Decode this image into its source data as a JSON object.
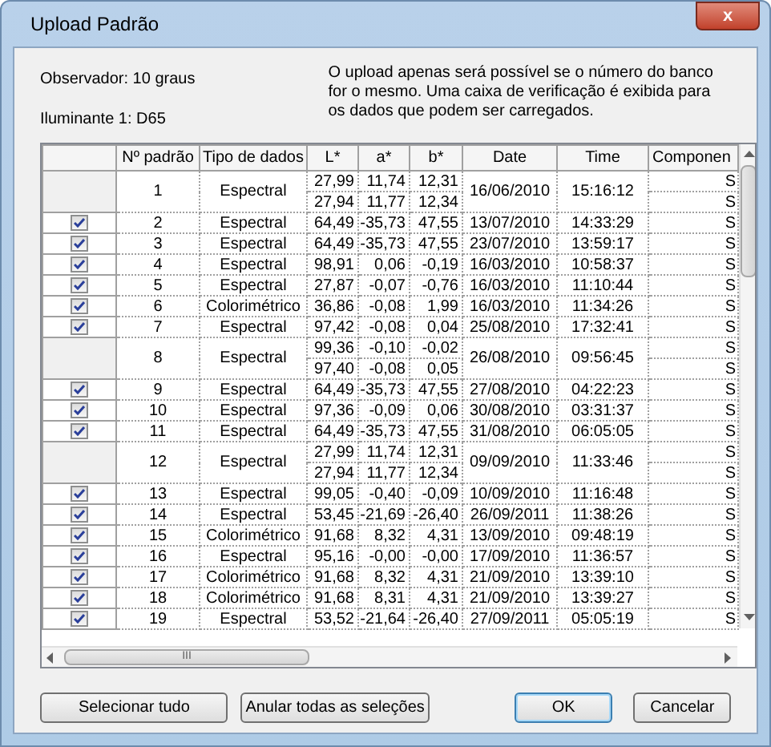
{
  "window": {
    "title": "Upload Padrão",
    "close": "x"
  },
  "info": {
    "observer": "Observador:  10 graus",
    "illuminant": "Iluminante 1:  D65",
    "note": "O upload apenas será possível se o número do banco for o mesmo. Uma caixa de verificação é exibida para os dados que podem ser carregados."
  },
  "table": {
    "columns": [
      "Nº padrão",
      "Tipo de dados",
      "L*",
      "a*",
      "b*",
      "Date",
      "Time",
      "Componen"
    ],
    "rows": [
      {
        "checked": false,
        "no": "1",
        "type": "Espectral",
        "L": [
          "27,99",
          "27,94"
        ],
        "a": [
          "11,74",
          "11,77"
        ],
        "b": [
          "12,31",
          "12,34"
        ],
        "date": "16/06/2010",
        "time": "15:16:12",
        "component": [
          "S",
          "S"
        ]
      },
      {
        "checked": true,
        "no": "2",
        "type": "Espectral",
        "L": [
          "64,49"
        ],
        "a": [
          "-35,73"
        ],
        "b": [
          "47,55"
        ],
        "date": "13/07/2010",
        "time": "14:33:29",
        "component": [
          "S"
        ]
      },
      {
        "checked": true,
        "no": "3",
        "type": "Espectral",
        "L": [
          "64,49"
        ],
        "a": [
          "-35,73"
        ],
        "b": [
          "47,55"
        ],
        "date": "23/07/2010",
        "time": "13:59:17",
        "component": [
          "S"
        ]
      },
      {
        "checked": true,
        "no": "4",
        "type": "Espectral",
        "L": [
          "98,91"
        ],
        "a": [
          "0,06"
        ],
        "b": [
          "-0,19"
        ],
        "date": "16/03/2010",
        "time": "10:58:37",
        "component": [
          "S"
        ]
      },
      {
        "checked": true,
        "no": "5",
        "type": "Espectral",
        "L": [
          "27,87"
        ],
        "a": [
          "-0,07"
        ],
        "b": [
          "-0,76"
        ],
        "date": "16/03/2010",
        "time": "11:10:44",
        "component": [
          "S"
        ]
      },
      {
        "checked": true,
        "no": "6",
        "type": "Colorimétrico",
        "L": [
          "36,86"
        ],
        "a": [
          "-0,08"
        ],
        "b": [
          "1,99"
        ],
        "date": "16/03/2010",
        "time": "11:34:26",
        "component": [
          "S"
        ]
      },
      {
        "checked": true,
        "no": "7",
        "type": "Espectral",
        "L": [
          "97,42"
        ],
        "a": [
          "-0,08"
        ],
        "b": [
          "0,04"
        ],
        "date": "25/08/2010",
        "time": "17:32:41",
        "component": [
          "S"
        ]
      },
      {
        "checked": false,
        "no": "8",
        "type": "Espectral",
        "L": [
          "99,36",
          "97,40"
        ],
        "a": [
          "-0,10",
          "-0,08"
        ],
        "b": [
          "-0,02",
          "0,05"
        ],
        "date": "26/08/2010",
        "time": "09:56:45",
        "component": [
          "S",
          "S"
        ]
      },
      {
        "checked": true,
        "no": "9",
        "type": "Espectral",
        "L": [
          "64,49"
        ],
        "a": [
          "-35,73"
        ],
        "b": [
          "47,55"
        ],
        "date": "27/08/2010",
        "time": "04:22:23",
        "component": [
          "S"
        ]
      },
      {
        "checked": true,
        "no": "10",
        "type": "Espectral",
        "L": [
          "97,36"
        ],
        "a": [
          "-0,09"
        ],
        "b": [
          "0,06"
        ],
        "date": "30/08/2010",
        "time": "03:31:37",
        "component": [
          "S"
        ]
      },
      {
        "checked": true,
        "no": "11",
        "type": "Espectral",
        "L": [
          "64,49"
        ],
        "a": [
          "-35,73"
        ],
        "b": [
          "47,55"
        ],
        "date": "31/08/2010",
        "time": "06:05:05",
        "component": [
          "S"
        ]
      },
      {
        "checked": false,
        "no": "12",
        "type": "Espectral",
        "L": [
          "27,99",
          "27,94"
        ],
        "a": [
          "11,74",
          "11,77"
        ],
        "b": [
          "12,31",
          "12,34"
        ],
        "date": "09/09/2010",
        "time": "11:33:46",
        "component": [
          "S",
          "S"
        ]
      },
      {
        "checked": true,
        "no": "13",
        "type": "Espectral",
        "L": [
          "99,05"
        ],
        "a": [
          "-0,40"
        ],
        "b": [
          "-0,09"
        ],
        "date": "10/09/2010",
        "time": "11:16:48",
        "component": [
          "S"
        ]
      },
      {
        "checked": true,
        "no": "14",
        "type": "Espectral",
        "L": [
          "53,45"
        ],
        "a": [
          "-21,69"
        ],
        "b": [
          "-26,40"
        ],
        "date": "26/09/2011",
        "time": "11:38:26",
        "component": [
          "S"
        ]
      },
      {
        "checked": true,
        "no": "15",
        "type": "Colorimétrico",
        "L": [
          "91,68"
        ],
        "a": [
          "8,32"
        ],
        "b": [
          "4,31"
        ],
        "date": "13/09/2010",
        "time": "09:48:19",
        "component": [
          "S"
        ]
      },
      {
        "checked": true,
        "no": "16",
        "type": "Espectral",
        "L": [
          "95,16"
        ],
        "a": [
          "-0,00"
        ],
        "b": [
          "-0,00"
        ],
        "date": "17/09/2010",
        "time": "11:36:57",
        "component": [
          "S"
        ]
      },
      {
        "checked": true,
        "no": "17",
        "type": "Colorimétrico",
        "L": [
          "91,68"
        ],
        "a": [
          "8,32"
        ],
        "b": [
          "4,31"
        ],
        "date": "21/09/2010",
        "time": "13:39:10",
        "component": [
          "S"
        ]
      },
      {
        "checked": true,
        "no": "18",
        "type": "Colorimétrico",
        "L": [
          "91,68"
        ],
        "a": [
          "8,31"
        ],
        "b": [
          "4,31"
        ],
        "date": "21/09/2010",
        "time": "13:39:27",
        "component": [
          "S"
        ]
      },
      {
        "checked": true,
        "no": "19",
        "type": "Espectral",
        "L": [
          "53,52"
        ],
        "a": [
          "-21,64"
        ],
        "b": [
          "-26,40"
        ],
        "date": "27/09/2011",
        "time": "05:05:19",
        "component": [
          "S"
        ]
      }
    ]
  },
  "scrollbar": {
    "grip": "III"
  },
  "buttons": [
    {
      "label": "Selecionar tudo",
      "default": false
    },
    {
      "label": "Anular todas as seleções",
      "default": false
    },
    {
      "label": "OK",
      "default": true
    },
    {
      "label": "Cancelar",
      "default": false
    }
  ]
}
